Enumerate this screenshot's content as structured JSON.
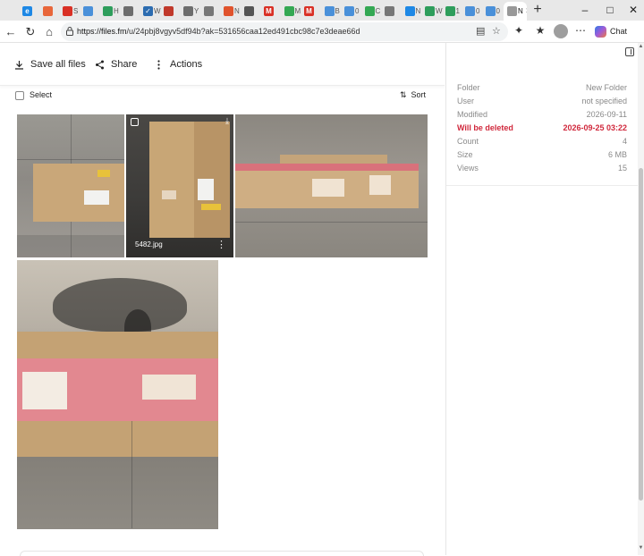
{
  "browser": {
    "tabs": [
      {
        "title": "",
        "favicon": "edge",
        "color": "#1e88e5",
        "glyph": "e"
      },
      {
        "title": "",
        "favicon": "firefox",
        "color": "#e8663a",
        "glyph": ""
      },
      {
        "title": "S",
        "favicon": "red",
        "color": "#d93025",
        "glyph": ""
      },
      {
        "title": "",
        "favicon": "onedrive",
        "color": "#4a90d9",
        "glyph": ""
      },
      {
        "title": "H",
        "favicon": "green",
        "color": "#2e9d5b",
        "glyph": ""
      },
      {
        "title": "",
        "favicon": "grid",
        "color": "#6d6d6d",
        "glyph": ""
      },
      {
        "title": "W",
        "favicon": "check",
        "color": "#2c6cb0",
        "glyph": "✓"
      },
      {
        "title": "",
        "favicon": "mail",
        "color": "#c0392b",
        "glyph": ""
      },
      {
        "title": "Y",
        "favicon": "cal",
        "color": "#6d6d6d",
        "glyph": ""
      },
      {
        "title": "",
        "favicon": "mail",
        "color": "#777",
        "glyph": ""
      },
      {
        "title": "N",
        "favicon": "circle",
        "color": "#e0532d",
        "glyph": ""
      },
      {
        "title": "",
        "favicon": "search",
        "color": "#555",
        "glyph": ""
      },
      {
        "title": "",
        "favicon": "gmail",
        "color": "#d93025",
        "glyph": "M"
      },
      {
        "title": "M",
        "favicon": "green",
        "color": "#34a853",
        "glyph": ""
      },
      {
        "title": "",
        "favicon": "gmail",
        "color": "#d93025",
        "glyph": "M"
      },
      {
        "title": "B",
        "favicon": "onedrive",
        "color": "#4a90d9",
        "glyph": ""
      },
      {
        "title": "0",
        "favicon": "onedrive",
        "color": "#4a90d9",
        "glyph": ""
      },
      {
        "title": "C",
        "favicon": "pin",
        "color": "#34a853",
        "glyph": ""
      },
      {
        "title": "",
        "favicon": "mail",
        "color": "#777",
        "glyph": ""
      },
      {
        "title": "N",
        "favicon": "edge",
        "color": "#1e88e5",
        "glyph": ""
      },
      {
        "title": "W",
        "favicon": "green",
        "color": "#2e9d5b",
        "glyph": ""
      },
      {
        "title": "1",
        "favicon": "green",
        "color": "#2e9d5b",
        "glyph": ""
      },
      {
        "title": "0",
        "favicon": "onedrive",
        "color": "#4a90d9",
        "glyph": ""
      },
      {
        "title": "0",
        "favicon": "onedrive",
        "color": "#4a90d9",
        "glyph": ""
      },
      {
        "title": "W",
        "favicon": "word",
        "color": "#2b579a",
        "glyph": "W"
      },
      {
        "title": "N",
        "favicon": "blank",
        "color": "#999",
        "glyph": "",
        "active": true
      }
    ],
    "url_host": "https://files.fm",
    "url_path": "/u/24pbj8vgyv5df94b?ak=531656caa12ed491cbc98c7e3deae66d",
    "chat_label": "Chat"
  },
  "actions": {
    "save_all": "Save all files",
    "share": "Share",
    "actions": "Actions"
  },
  "toolbar2": {
    "select": "Select",
    "sort": "Sort"
  },
  "photos": [
    {
      "name": ""
    },
    {
      "name": "5482.jpg"
    },
    {
      "name": ""
    },
    {
      "name": ""
    }
  ],
  "info": {
    "rows": [
      {
        "key": "Folder",
        "value": "New Folder"
      },
      {
        "key": "User",
        "value": "not specified"
      },
      {
        "key": "Modified",
        "value": "2026-09-11"
      },
      {
        "key": "Will be deleted",
        "value": "2026-09-25 03:22",
        "warn": true
      },
      {
        "key": "Count",
        "value": "4"
      },
      {
        "key": "Size",
        "value": "6 MB"
      },
      {
        "key": "Views",
        "value": "15"
      }
    ]
  },
  "colors": {
    "warn": "#d0283c",
    "box_cardboard": "#c6a57a",
    "box_stripe": "#d9717b"
  }
}
